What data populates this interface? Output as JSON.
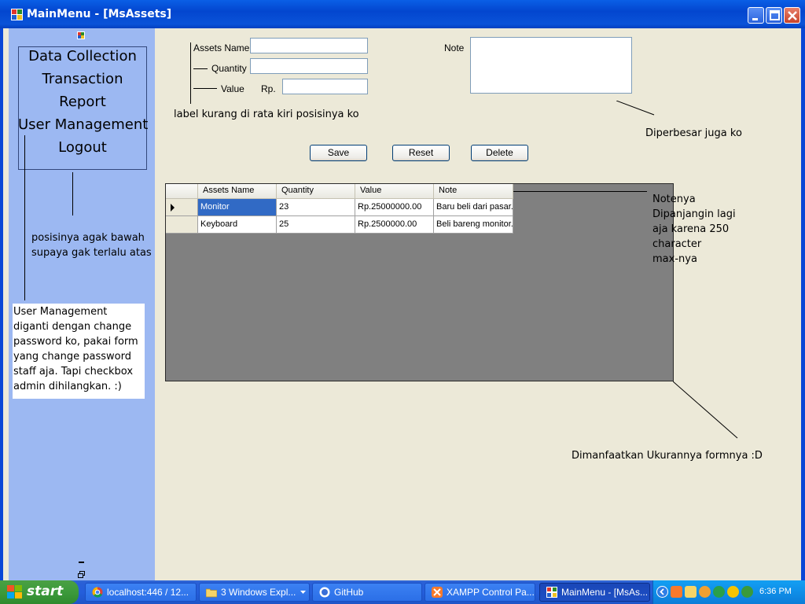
{
  "window": {
    "title": "MainMenu - [MsAssets]"
  },
  "sidebar": {
    "menu": [
      "Data Collection",
      "Transaction",
      "Report",
      "User Management",
      "Logout"
    ],
    "notes": {
      "position": [
        "posisinya agak bawah",
        "supaya gak terlalu atas"
      ],
      "user_management": [
        "User Management",
        "diganti dengan change",
        "password ko, pakai form",
        "yang change password",
        "staff aja. Tapi checkbox",
        "admin dihilangkan. :)"
      ]
    }
  },
  "form": {
    "assets_name_label": "Assets Name",
    "quantity_label": "Quantity",
    "value_label": "Value",
    "value_prefix": "Rp.",
    "note_label": "Note",
    "assets_name_value": "",
    "quantity_value": "",
    "value_value": "",
    "note_value": "",
    "buttons": {
      "save": "Save",
      "reset": "Reset",
      "delete": "Delete"
    }
  },
  "annotations": {
    "label_left": "label kurang di rata kiri posisinya ko",
    "note_bigger": "Diperbesar juga ko",
    "note_longer": [
      "Notenya",
      "Dipanjangin lagi",
      "aja karena 250",
      "character",
      "max-nya"
    ],
    "form_size": "Dimanfaatkan Ukurannya formnya :D"
  },
  "grid": {
    "columns": [
      "Assets Name",
      "Quantity",
      "Value",
      "Note"
    ],
    "rows": [
      {
        "name": "Monitor",
        "quantity": "23",
        "value": "Rp.25000000.00",
        "note": "Baru beli dari pasar."
      },
      {
        "name": "Keyboard",
        "quantity": "25",
        "value": "Rp.2500000.00",
        "note": "Beli bareng monitor."
      }
    ]
  },
  "taskbar": {
    "start": "start",
    "tasks": [
      "localhost:446 / 12...",
      "3 Windows Expl...",
      "GitHub",
      "XAMPP Control Pa...",
      "MainMenu - [MsAs..."
    ],
    "clock": "6:36 PM"
  }
}
